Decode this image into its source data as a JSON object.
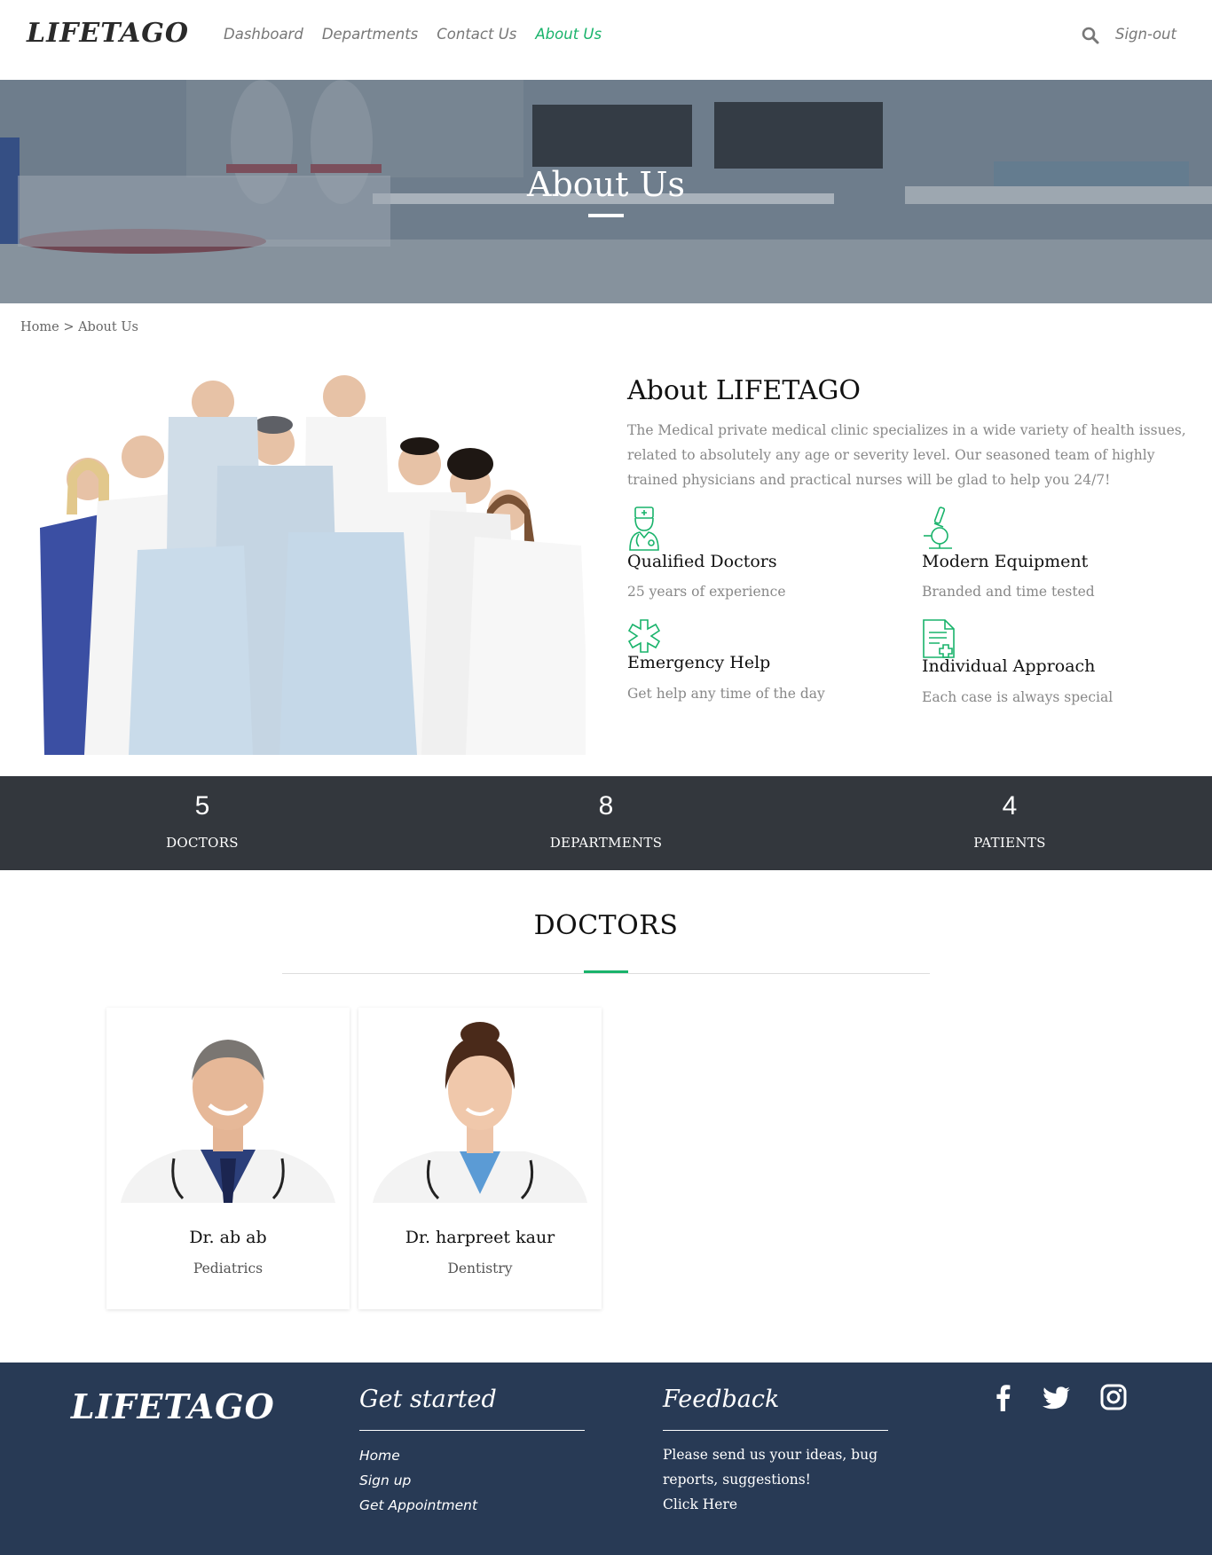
{
  "nav": {
    "logo": "LIFETAGO",
    "links": [
      {
        "label": "Dashboard"
      },
      {
        "label": "Departments"
      },
      {
        "label": "Contact Us"
      },
      {
        "label": "About Us"
      }
    ],
    "active": "About Us",
    "signout": "Sign-out",
    "search_icon": "search-icon"
  },
  "hero": {
    "title": "About Us"
  },
  "breadcrumb": "Home > About Us",
  "about": {
    "title": "About LIFETAGO",
    "text": "The Medical private medical clinic specializes in a wide variety of health issues, related to absolutely any age or severity level. Our seasoned team of highly trained physicians and practical nurses will be glad to help you 24/7!",
    "features": [
      {
        "icon": "doctor-icon",
        "title": "Qualified Doctors",
        "subtitle": "25 years of experience"
      },
      {
        "icon": "microscope-icon",
        "title": "Modern Equipment",
        "subtitle": "Branded and time tested"
      },
      {
        "icon": "medical-star-icon",
        "title": "Emergency Help",
        "subtitle": "Get help any time of the day"
      },
      {
        "icon": "medical-document-icon",
        "title": "Individual Approach",
        "subtitle": "Each case is always special"
      }
    ]
  },
  "stats": [
    {
      "value": "5",
      "label": "DOCTORS"
    },
    {
      "value": "8",
      "label": "DEPARTMENTS"
    },
    {
      "value": "4",
      "label": "PATIENTS"
    }
  ],
  "doctors": {
    "title": "DOCTORS",
    "items": [
      {
        "name": "Dr. ab ab",
        "department": "Pediatrics"
      },
      {
        "name": "Dr. harpreet kaur",
        "department": "Dentistry"
      }
    ]
  },
  "footer": {
    "logo": "LIFETAGO",
    "get_started": {
      "title": "Get started",
      "links": [
        "Home",
        "Sign up",
        "Get Appointment"
      ]
    },
    "feedback": {
      "title": "Feedback",
      "text": "Please send us your ideas, bug reports, suggestions!",
      "link": "Click Here"
    },
    "social": [
      "facebook-icon",
      "twitter-icon",
      "instagram-icon"
    ]
  },
  "colors": {
    "accent": "#19b36b",
    "stats_bg": "#33373d",
    "footer_bg": "#283a55"
  }
}
